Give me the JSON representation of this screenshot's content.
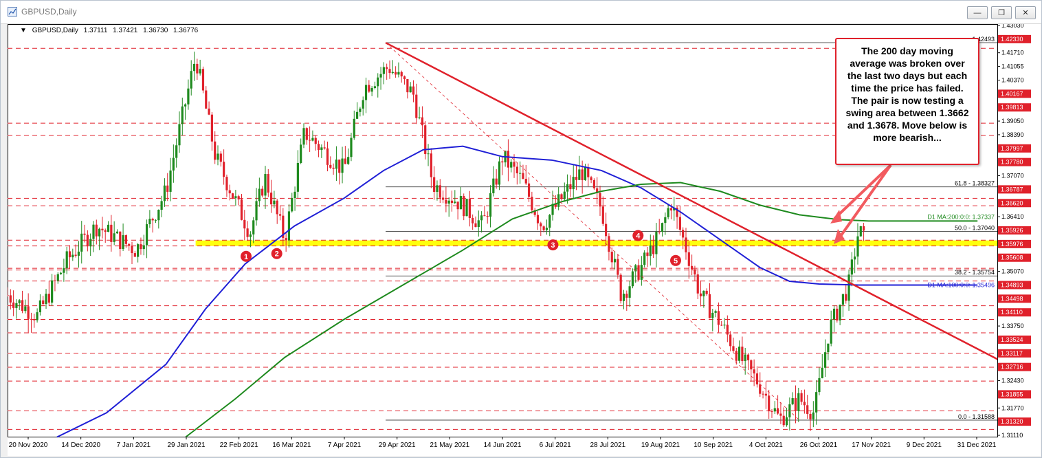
{
  "window": {
    "title": "GBPUSD,Daily"
  },
  "window_buttons": {
    "minimize": "—",
    "restore": "❐",
    "close": "✕"
  },
  "header": {
    "symbol": "GBPUSD,Daily",
    "open": "1.37111",
    "high": "1.37421",
    "low": "1.36730",
    "close": "1.36776"
  },
  "annotation": "The 200 day moving average was broken over the last two days but each time the price has failed. The pair is now testing a swing area between 1.3662 and 1.3678.  Move below is more bearish...",
  "chart_data": {
    "type": "candlestick",
    "title": "GBPUSD,Daily",
    "ylim": [
      1.3111,
      1.4303
    ],
    "price_axis_ticks": [
      "1.43030",
      "1.42330",
      "1.41710",
      "1.41055",
      "1.40370",
      "1.40167",
      "1.39813",
      "1.39050",
      "1.38390",
      "1.37997",
      "1.37780",
      "1.37070",
      "1.36787",
      "1.36620",
      "1.36410",
      "1.35926",
      "1.35976",
      "1.35608",
      "1.35070",
      "1.34893",
      "1.34498",
      "1.34110",
      "1.33750",
      "1.33524",
      "1.33117",
      "1.32716",
      "1.32430",
      "1.31855",
      "1.31770",
      "1.31320",
      "1.31110"
    ],
    "date_axis_ticks": [
      "20 Nov 2020",
      "14 Dec 2020",
      "7 Jan 2021",
      "29 Jan 2021",
      "22 Feb 2021",
      "16 Mar 2021",
      "7 Apr 2021",
      "29 Apr 2021",
      "21 May 2021",
      "14 Jun 2021",
      "6 Jul 2021",
      "28 Jul 2021",
      "19 Aug 2021",
      "10 Sep 2021",
      "4 Oct 2021",
      "26 Oct 2021",
      "17 Nov 2021",
      "9 Dec 2021",
      "31 Dec 2021"
    ],
    "highlighted_levels": [
      {
        "value": 1.4233,
        "label": "1.42330",
        "color": "#e0212b"
      },
      {
        "value": 1.40167,
        "label": "1.40167",
        "color": "#e0212b"
      },
      {
        "value": 1.39813,
        "label": "1.39813",
        "color": "#e0212b"
      },
      {
        "value": 1.37997,
        "label": "1.37997",
        "color": "#e0212b"
      },
      {
        "value": 1.3778,
        "label": "1.37780",
        "color": "#e0212b"
      },
      {
        "value": 1.36787,
        "label": "1.36787",
        "color": "#e0212b"
      },
      {
        "value": 1.3662,
        "label": "1.36620",
        "color": "#e0212b"
      },
      {
        "value": 1.35926,
        "label": "1.35926",
        "color": "#e0212b"
      },
      {
        "value": 1.35976,
        "label": "1.35976",
        "color": "#e0212b"
      },
      {
        "value": 1.35608,
        "label": "1.35608",
        "color": "#e0212b"
      },
      {
        "value": 1.34893,
        "label": "1.34893",
        "color": "#e0212b"
      },
      {
        "value": 1.34498,
        "label": "1.34498",
        "color": "#e0212b"
      },
      {
        "value": 1.3411,
        "label": "1.34110",
        "color": "#e0212b"
      },
      {
        "value": 1.33524,
        "label": "1.33524",
        "color": "#e0212b"
      },
      {
        "value": 1.33117,
        "label": "1.33117",
        "color": "#e0212b"
      },
      {
        "value": 1.32716,
        "label": "1.32716",
        "color": "#e0212b"
      },
      {
        "value": 1.31855,
        "label": "1.31855",
        "color": "#e0212b"
      },
      {
        "value": 1.3132,
        "label": "1.31320",
        "color": "#e0212b"
      }
    ],
    "fib_levels": [
      {
        "value": 1.42493,
        "label": "1.42493"
      },
      {
        "value": 1.38327,
        "label": "61.8 - 1.38327"
      },
      {
        "value": 1.3704,
        "label": "50.0 - 1.37040"
      },
      {
        "value": 1.35754,
        "label": "38.2 - 1.35754"
      },
      {
        "value": 1.31588,
        "label": "0.0 - 1.31588"
      }
    ],
    "moving_averages": [
      {
        "name": "D1 MA:200:0:0: 1.37337",
        "color": "#1e8a1e"
      },
      {
        "name": "D1 MA:100:0:0: 1.35496",
        "color": "#1f1fd6"
      }
    ],
    "swing_area": [
      1.3662,
      1.3678
    ],
    "swing_points": [
      "1",
      "2",
      "3",
      "4",
      "5"
    ],
    "colors": {
      "bull": "#1e8a1e",
      "bear": "#e0212b",
      "ma100": "#1f1fd6",
      "ma200": "#1e8a1e",
      "trendline": "#e0212b",
      "swing_zone": "#ffff00"
    }
  }
}
